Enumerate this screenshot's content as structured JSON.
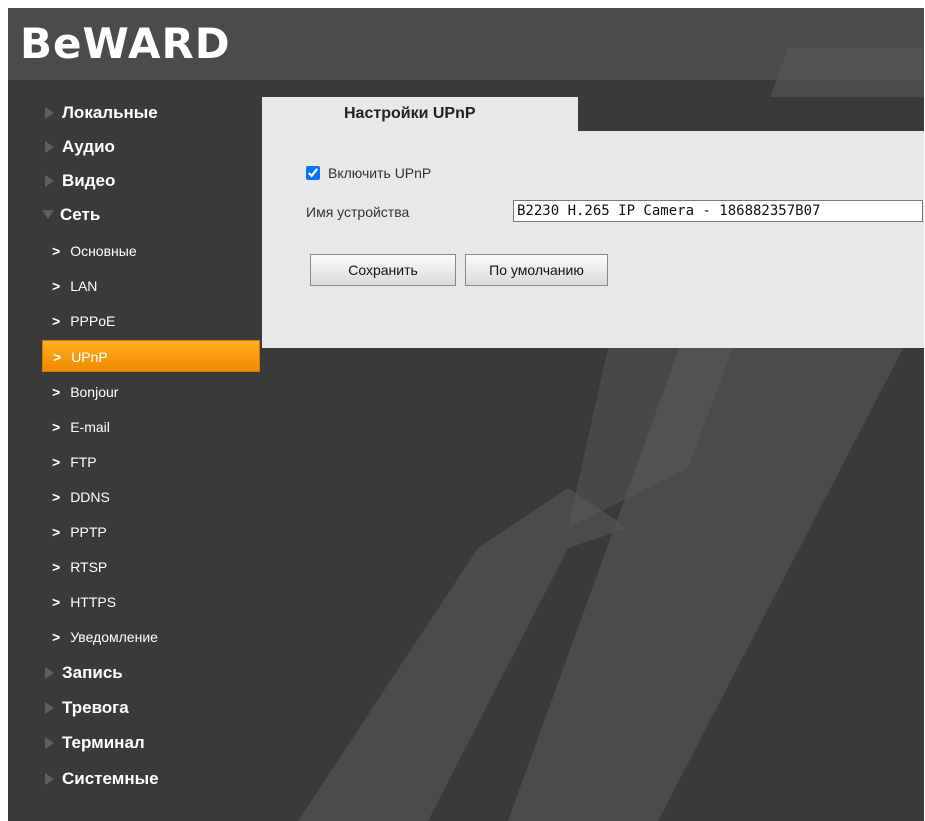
{
  "brand": {
    "logo": "BeWARD"
  },
  "sidebar": {
    "top_items": [
      {
        "label": "Локальные"
      },
      {
        "label": "Аудио"
      },
      {
        "label": "Видео"
      },
      {
        "label": "Сеть"
      },
      {
        "label": "Запись"
      },
      {
        "label": "Тревога"
      },
      {
        "label": "Терминал"
      },
      {
        "label": "Системные"
      }
    ],
    "network_sub_items": [
      {
        "label": "Основные"
      },
      {
        "label": "LAN"
      },
      {
        "label": "PPPoE"
      },
      {
        "label": "UPnP"
      },
      {
        "label": "Bonjour"
      },
      {
        "label": "E-mail"
      },
      {
        "label": "FTP"
      },
      {
        "label": "DDNS"
      },
      {
        "label": "PPTP"
      },
      {
        "label": "RTSP"
      },
      {
        "label": "HTTPS"
      },
      {
        "label": "Уведомление"
      }
    ],
    "active_sub": "UPnP"
  },
  "panel": {
    "tab_title": "Настройки UPnP",
    "enable_label": "Включить UPnP",
    "enable_checked": true,
    "device_name_label": "Имя устройства",
    "device_name_value": "B2230 H.265 IP Camera - 186882357B07",
    "save_label": "Сохранить",
    "default_label": "По умолчанию"
  },
  "colors": {
    "background": "#3a3a3a",
    "header": "#4b4b4b",
    "active_item": "#f5a000",
    "panel": "#e8e8e8"
  }
}
